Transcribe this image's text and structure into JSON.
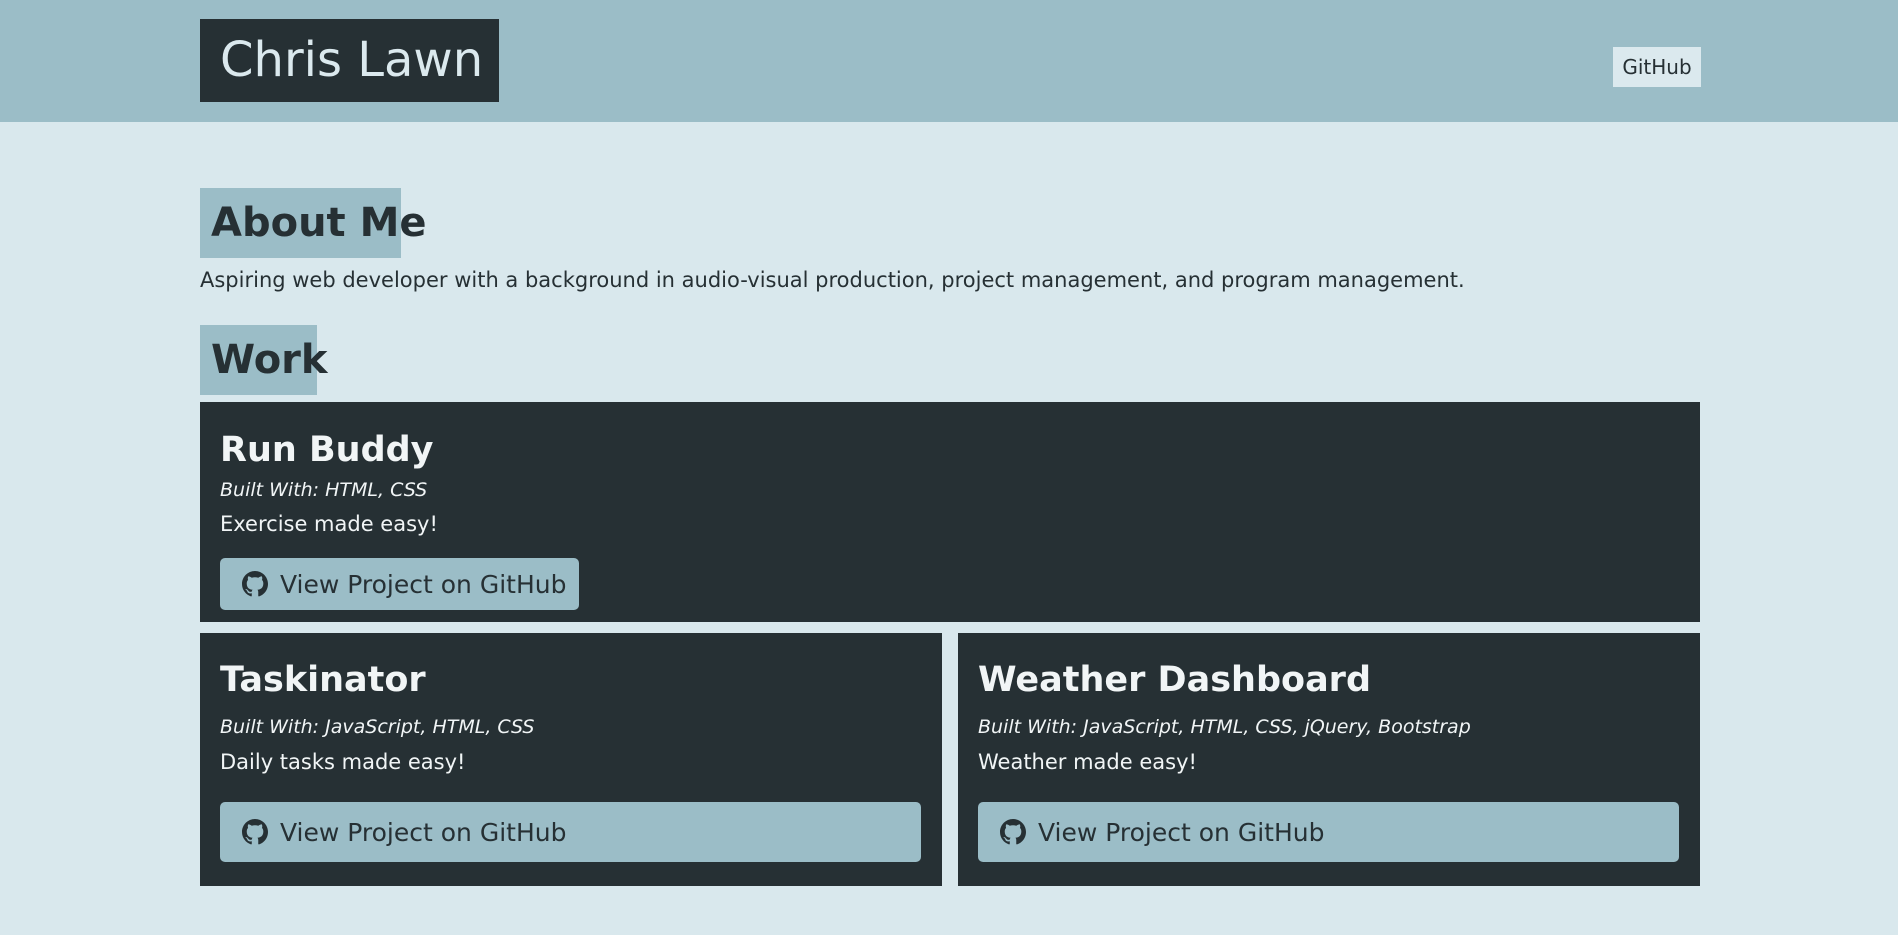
{
  "header": {
    "brand": "Chris Lawn",
    "nav_github": "GitHub"
  },
  "about": {
    "heading": "About Me",
    "text": "Aspiring web developer with a background in audio-visual production, project management, and program management."
  },
  "work": {
    "heading": "Work",
    "projects": [
      {
        "title": "Run Buddy",
        "built_with": "Built With: HTML, CSS",
        "description": "Exercise made easy!",
        "button_label": "View Project on GitHub"
      },
      {
        "title": "Taskinator",
        "built_with": "Built With: JavaScript, HTML, CSS",
        "description": "Daily tasks made easy!",
        "button_label": "View Project on GitHub"
      },
      {
        "title": "Weather Dashboard",
        "built_with": "Built With: JavaScript, HTML, CSS, jQuery, Bootstrap",
        "description": "Weather made easy!",
        "button_label": "View Project on GitHub"
      }
    ]
  },
  "icons": {
    "button_icon": "github-icon"
  },
  "colors": {
    "page_background": "#d9e8ed",
    "header_background": "#9bbdc7",
    "dark": "#263034",
    "light_text": "#f1f5f6",
    "accent": "#9bbdc7"
  }
}
